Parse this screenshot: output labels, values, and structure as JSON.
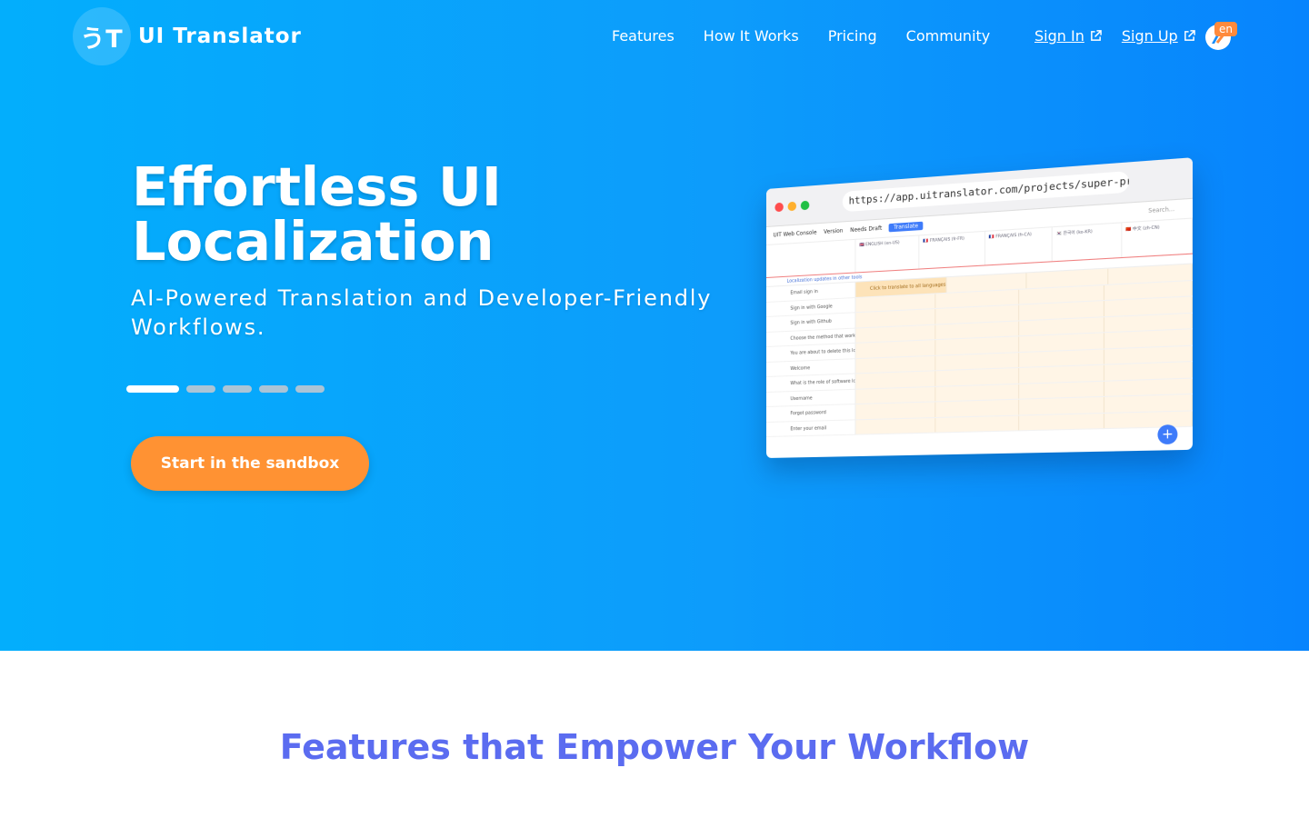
{
  "brand": {
    "logo_glyph": "うT",
    "name": "UI Translator"
  },
  "nav": {
    "items": [
      "Features",
      "How It Works",
      "Pricing",
      "Community"
    ]
  },
  "auth": {
    "sign_in": "Sign In",
    "sign_up": "Sign Up"
  },
  "language": {
    "code": "en"
  },
  "hero": {
    "headline": "Effortless UI Localization",
    "subheadline": "AI-Powered Translation and Developer-Friendly Workflows.",
    "cta": "Start in the sandbox",
    "carousel": {
      "slides": 5,
      "active_index": 0
    }
  },
  "preview": {
    "url": "https://app.uitranslator.com/projects/super-project",
    "app_title": "UIT Web Console",
    "branch_label": "Version",
    "branch_value": "Needs Draft",
    "action_button": "Translate",
    "search_placeholder": "Search...",
    "columns": [
      "🇬🇧 ENGLISH (en-US)",
      "🇫🇷 FRANÇAIS (fr-FR)",
      "🇫🇷 FRANÇAIS (fr-CA)",
      "🇰🇷 한국어 (ko-KR)",
      "🇨🇳 中文 (zh-CN)"
    ],
    "banner": "Localization updates in other tools",
    "highlight_text": "Click to translate to all languages",
    "rows": [
      "Email sign in",
      "Sign in with Google",
      "Sign in with Github",
      "Choose the method that works best for you",
      "You are about to delete this localization entry",
      "Welcome",
      "What is the role of software localization",
      "Username",
      "Forgot password",
      "Enter your email"
    ]
  },
  "features": {
    "title": "Features that Empower Your Workflow"
  },
  "colors": {
    "hero_start": "#03aefc",
    "hero_end": "#0784fd",
    "cta": "#ff9233",
    "features_title": "#5b6cf0"
  }
}
